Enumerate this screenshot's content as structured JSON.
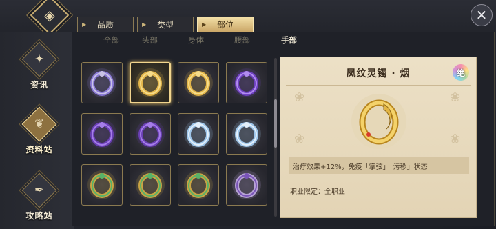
{
  "header": {
    "logo_icon": "◈",
    "close_icon": "✕"
  },
  "nav": [
    {
      "label": "资讯",
      "icon": "horn-icon",
      "glyph": "✦",
      "active": false
    },
    {
      "label": "资料站",
      "icon": "scroll-icon",
      "glyph": "❦",
      "active": true
    },
    {
      "label": "攻略站",
      "icon": "quill-icon",
      "glyph": "✒",
      "active": false
    }
  ],
  "tabs": [
    {
      "label": "品质",
      "active": false
    },
    {
      "label": "类型",
      "active": false
    },
    {
      "label": "部位",
      "active": true
    }
  ],
  "sub_categories": [
    {
      "label": "全部",
      "active": false
    },
    {
      "label": "头部",
      "active": false
    },
    {
      "label": "身体",
      "active": false
    },
    {
      "label": "腰部",
      "active": false
    },
    {
      "label": "手部",
      "active": true
    }
  ],
  "items": [
    {
      "icon": "silver-purple-bangle-icon",
      "color": "#8b7ad6",
      "band": "#c9c3e6",
      "selected": false
    },
    {
      "icon": "gold-phoenix-bangle-icon",
      "color": "#e3b64a",
      "band": "#f6dc8a",
      "selected": true
    },
    {
      "icon": "gold-phoenix-bangle-icon",
      "color": "#e3b64a",
      "band": "#f6dc8a",
      "selected": false
    },
    {
      "icon": "purple-jeweled-ring-icon",
      "color": "#6f42c1",
      "band": "#b18cf0",
      "selected": false
    },
    {
      "icon": "purple-gem-ring-icon",
      "color": "#6a3fb5",
      "band": "#a57de8",
      "selected": false
    },
    {
      "icon": "purple-gem-ring-icon",
      "color": "#6a3fb5",
      "band": "#a57de8",
      "selected": false
    },
    {
      "icon": "silver-blue-bangle-icon",
      "color": "#9fc6ea",
      "band": "#e4f0fb",
      "selected": false
    },
    {
      "icon": "silver-blue-bangle-icon",
      "color": "#9fc6ea",
      "band": "#e4f0fb",
      "selected": false
    },
    {
      "icon": "gold-green-gem-bangle-icon",
      "color": "#c9a444",
      "band": "#58b368",
      "selected": false
    },
    {
      "icon": "gold-green-gem-bangle-icon",
      "color": "#c9a444",
      "band": "#58b368",
      "selected": false
    },
    {
      "icon": "gold-green-gem-bangle-icon",
      "color": "#c9a444",
      "band": "#58b368",
      "selected": false
    },
    {
      "icon": "silver-purple-ring-icon",
      "color": "#b7a3d6",
      "band": "#7a55b8",
      "selected": false
    }
  ],
  "detail": {
    "title": "凤纹灵镯 · 烟",
    "rarity_badge": "绝",
    "icon": "gold-phoenix-bangle-icon",
    "description": "治疗效果+12%，免疫「掌弦」「污秽」状态",
    "requirement": "职业限定：全职业"
  }
}
